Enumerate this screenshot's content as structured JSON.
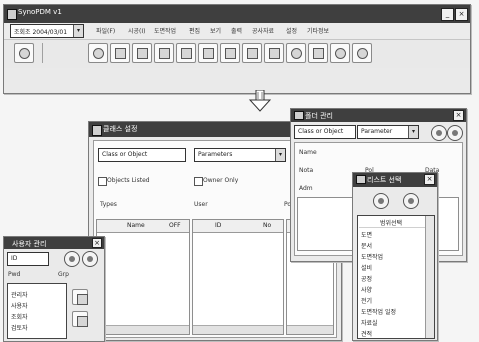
{
  "main_window": {
    "title": "SynoPDM v1",
    "combo_value": "조회조 2004/03/01",
    "menu": [
      "파일(F)",
      "시공(I)",
      "도면작업",
      "편집",
      "보기",
      "출력",
      "공사자료",
      "설정",
      "기타정보"
    ]
  },
  "class_window": {
    "title": "클래스 설정",
    "class_combo_label": "Class or Object",
    "class_combo_value": "Parameters",
    "check_objects_listed": "Objects Listed",
    "check_owner_only": "Owner Only",
    "types_label": "Types",
    "user_label": "User",
    "right_label": "Pos",
    "col_name": "Name",
    "col_off": "OFF",
    "col_id": "ID",
    "col_no": "No"
  },
  "right_window": {
    "title": "폴더 관리",
    "combo_value": "Class or Object",
    "combo_value2": "Parameter",
    "col_labels": [
      "Pol",
      "Data"
    ],
    "fields": [
      "Name",
      "Nota",
      "Adm"
    ]
  },
  "list_window": {
    "title": "리스트 선택",
    "header": "범위선택",
    "items": [
      "도면",
      "문서",
      "도면작업",
      "설비",
      "공정",
      "사양",
      "전기",
      "도면작업 일정",
      "자료실",
      "견적"
    ]
  },
  "small_window": {
    "title": "사용자 관리",
    "fields": [
      "ID",
      "Pwd",
      "Grp"
    ],
    "items": [
      "관리자",
      "사용자",
      "조회자",
      "검토자"
    ]
  },
  "colors": {
    "titlebar": "#3f3f3f",
    "window_bg": "#eaeaea",
    "border": "#7a7a7a"
  }
}
